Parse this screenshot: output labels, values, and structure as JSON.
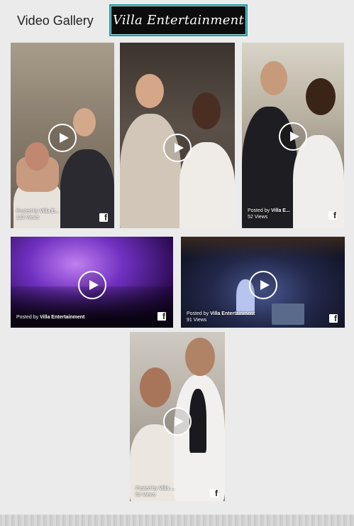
{
  "header": {
    "title": "Video Gallery",
    "logo_text": "Villa Entertainment"
  },
  "videos": [
    {
      "posted_prefix": "Posted by",
      "author": "Villa E...",
      "views": "123 Views"
    },
    {
      "posted_prefix": "",
      "author": "",
      "views": ""
    },
    {
      "posted_prefix": "Posted by",
      "author": "Villa E...",
      "views": "52 Views"
    },
    {
      "posted_prefix": "Posted by",
      "author": "Villa Entertainment",
      "views": ""
    },
    {
      "posted_prefix": "Posted by",
      "author": "Villa Entertainment",
      "views": "91 Views"
    },
    {
      "posted_prefix": "Posted by",
      "author": "Villa ...",
      "views": "54 Views"
    }
  ],
  "icons": {
    "play": "play-icon",
    "facebook": "facebook-icon",
    "facebook_glyph": "f"
  },
  "colors": {
    "logo_border": "#1e9ea4",
    "page_background": "#ebebeb"
  }
}
